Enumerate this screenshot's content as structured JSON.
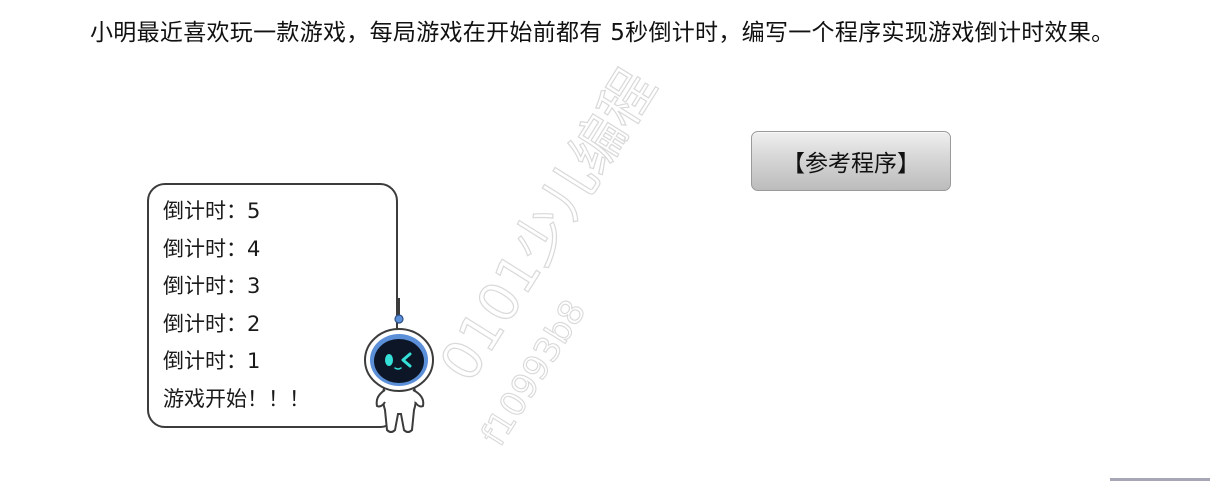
{
  "problem": {
    "text": "小明最近喜欢玩一款游戏，每局游戏在开始前都有 5秒倒计时，编写一个程序实现游戏倒计时效果。"
  },
  "reference_button": {
    "label": "【参考程序】"
  },
  "console_output": {
    "lines": [
      "倒计时：5",
      "倒计时：4",
      "倒计时：3",
      "倒计时：2",
      "倒计时：1",
      "游戏开始！！！"
    ]
  },
  "watermark": {
    "brand": "0101少儿编程",
    "code": "f10993b8"
  },
  "colors": {
    "text": "#111111",
    "button_top": "#efefef",
    "button_bottom": "#bcbcbc",
    "box_border": "#3c3c3c",
    "mascot_face": "#0c1626",
    "mascot_eyes": "#35e0d8",
    "mascot_ring": "#5b8fd8",
    "watermark": "#d9d9d9",
    "divider": "#a6a6b4"
  }
}
